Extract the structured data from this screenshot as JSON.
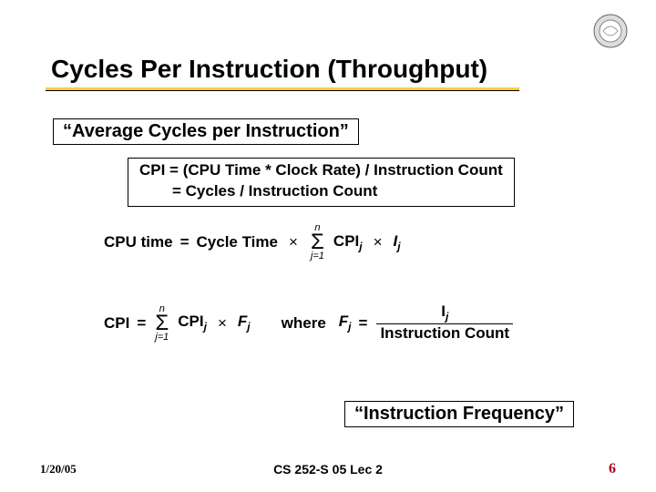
{
  "title": "Cycles Per Instruction (Throughput)",
  "section_label": "“Average Cycles per Instruction”",
  "cpi_formula": {
    "line1": "CPI = (CPU Time * Clock Rate) / Instruction Count",
    "line2": "=  Cycles / Instruction Count"
  },
  "math": {
    "cpu_time_label": "CPU time",
    "eq": "=",
    "cycle_time_label": "Cycle Time",
    "times": "×",
    "sigma_top": "n",
    "sigma_mid": "Σ",
    "sigma_bot": "j=1",
    "cpi_term": "CPI",
    "sub_j": "j",
    "i_term": "I",
    "cpi_label": "CPI",
    "f_term": "F",
    "where": "where",
    "f_eq_lhs": "F",
    "frac_num": "I",
    "frac_num_sub": "j",
    "frac_den": "Instruction Count"
  },
  "instr_freq_label": "“Instruction Frequency”",
  "footer": {
    "date": "1/20/05",
    "course": "CS 252-S 05 Lec 2",
    "page": "6"
  }
}
